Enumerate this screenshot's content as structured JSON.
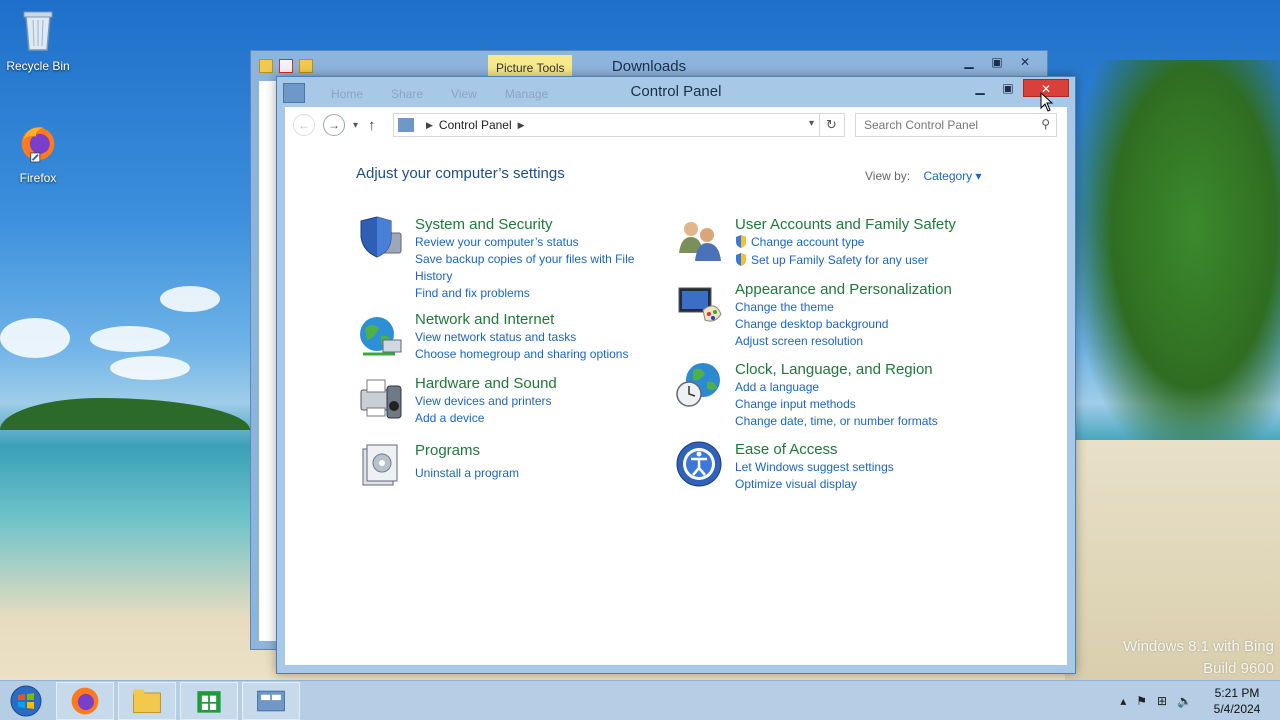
{
  "desktop": {
    "icons": [
      {
        "label": "Recycle Bin",
        "icon": "recycle-bin-icon"
      },
      {
        "label": "Firefox",
        "icon": "firefox-icon"
      }
    ],
    "watermark": {
      "line1": "Windows 8.1 with Bing",
      "line2": "Build 9600"
    }
  },
  "downloads_window": {
    "title": "Downloads",
    "contextual_tab": "Picture Tools"
  },
  "control_panel": {
    "title": "Control Panel",
    "ribbon_tabs": [
      "Home",
      "Share",
      "View",
      "Manage"
    ],
    "address": {
      "breadcrumb": "Control Panel"
    },
    "search": {
      "placeholder": "Search Control Panel"
    },
    "heading": "Adjust your computer’s settings",
    "view_by": {
      "label": "View by:",
      "value": "Category"
    },
    "categories": [
      {
        "title": "System and Security",
        "icon": "shield-computer-icon",
        "links": [
          "Review your computer’s status",
          "Save backup copies of your files with File History",
          "Find and fix problems"
        ]
      },
      {
        "title": "Network and Internet",
        "icon": "globe-network-icon",
        "links": [
          "View network status and tasks",
          "Choose homegroup and sharing options"
        ]
      },
      {
        "title": "Hardware and Sound",
        "icon": "printer-speaker-icon",
        "links": [
          "View devices and printers",
          "Add a device"
        ]
      },
      {
        "title": "Programs",
        "icon": "programs-box-icon",
        "links": [
          "Uninstall a program"
        ]
      },
      {
        "title": "User Accounts and Family Safety",
        "icon": "users-icon",
        "links": [
          "Change account type",
          "Set up Family Safety for any user"
        ]
      },
      {
        "title": "Appearance and Personalization",
        "icon": "monitor-palette-icon",
        "links": [
          "Change the theme",
          "Change desktop background",
          "Adjust screen resolution"
        ]
      },
      {
        "title": "Clock, Language, and Region",
        "icon": "clock-globe-icon",
        "links": [
          "Add a language",
          "Change input methods",
          "Change date, time, or number formats"
        ]
      },
      {
        "title": "Ease of Access",
        "icon": "ease-of-access-icon",
        "links": [
          "Let Windows suggest settings",
          "Optimize visual display"
        ]
      }
    ]
  },
  "taskbar": {
    "apps": [
      "firefox-icon",
      "file-explorer-icon",
      "store-icon",
      "control-panel-icon"
    ],
    "time": "5:21 PM",
    "date": "5/4/2024"
  },
  "colors": {
    "link": "#1a66c6",
    "category_title": "#1e7a3a",
    "heading": "#1f4e8c",
    "close_button": "#d9403a"
  }
}
